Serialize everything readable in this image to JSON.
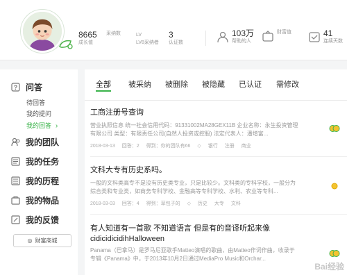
{
  "header": {
    "stats": [
      {
        "num": "8665",
        "label": "成长值"
      },
      {
        "num": "",
        "label": "采纳数"
      },
      {
        "num": "LV",
        "label": "LV8采纳者"
      },
      {
        "num": "3",
        "label": "认证数"
      }
    ],
    "icon_stats": [
      {
        "icon": "user-icon",
        "num": "103万",
        "label": "帮助的人"
      },
      {
        "icon": "wealth-icon",
        "num": "",
        "label": "财富值"
      },
      {
        "icon": "calendar-icon",
        "num": "41",
        "label": "连续天数"
      }
    ]
  },
  "nav": {
    "sections": [
      {
        "label": "问答",
        "icon": "question-icon"
      },
      {
        "label": "我的团队",
        "icon": "team-icon"
      },
      {
        "label": "我的任务",
        "icon": "task-icon"
      },
      {
        "label": "我的历程",
        "icon": "history-icon"
      },
      {
        "label": "我的物品",
        "icon": "goods-icon"
      },
      {
        "label": "我的反馈",
        "icon": "feedback-icon"
      }
    ],
    "qa_sub": [
      "待回答",
      "我的提问",
      "我的回答"
    ],
    "shop_button": "财富商城"
  },
  "tabs": [
    "全部",
    "被采纳",
    "被删除",
    "被隐藏",
    "已认证",
    "需修改"
  ],
  "items": [
    {
      "title": "工商注册号查询",
      "desc": "营业执照信息 统一社会信用代码：91331002MA28GEX11B 企业名称：永生投资管理有限公司 类型：有限责任公司(自然人投资或控股) 法定代表人：潘增富...",
      "meta": [
        "2018-03-13",
        "回答：2",
        "得到：你的团队有66",
        "银行",
        "注册",
        "商业"
      ],
      "medal": "gold"
    },
    {
      "title": "文科大专有历史系吗。",
      "desc": "一般的文科类高专不是没有历史类专业，只是比较少。文科类的专科学校，一般分为综合类和专业类，如商务专科学校、金融高等专科学校、水利、农业等专科...",
      "meta": [
        "2018-03-03",
        "回答：4",
        "得到：草包子的",
        "历史",
        "大专",
        "文科"
      ],
      "medal": "small"
    },
    {
      "title": "有人知道有一首歌 不知道语言 但是有的音译听起来像cidicidicidihHalloween",
      "desc": "Panama（巴拿马）是罗马尼亚歌手Matteo演唱的歌曲，由Matteo作词作曲，收录于专辑《Panama》中，于2013年10月2日通过MediaPro Music和Orchar...",
      "meta": [],
      "medal": "gold"
    }
  ],
  "watermark": "Bai经验"
}
